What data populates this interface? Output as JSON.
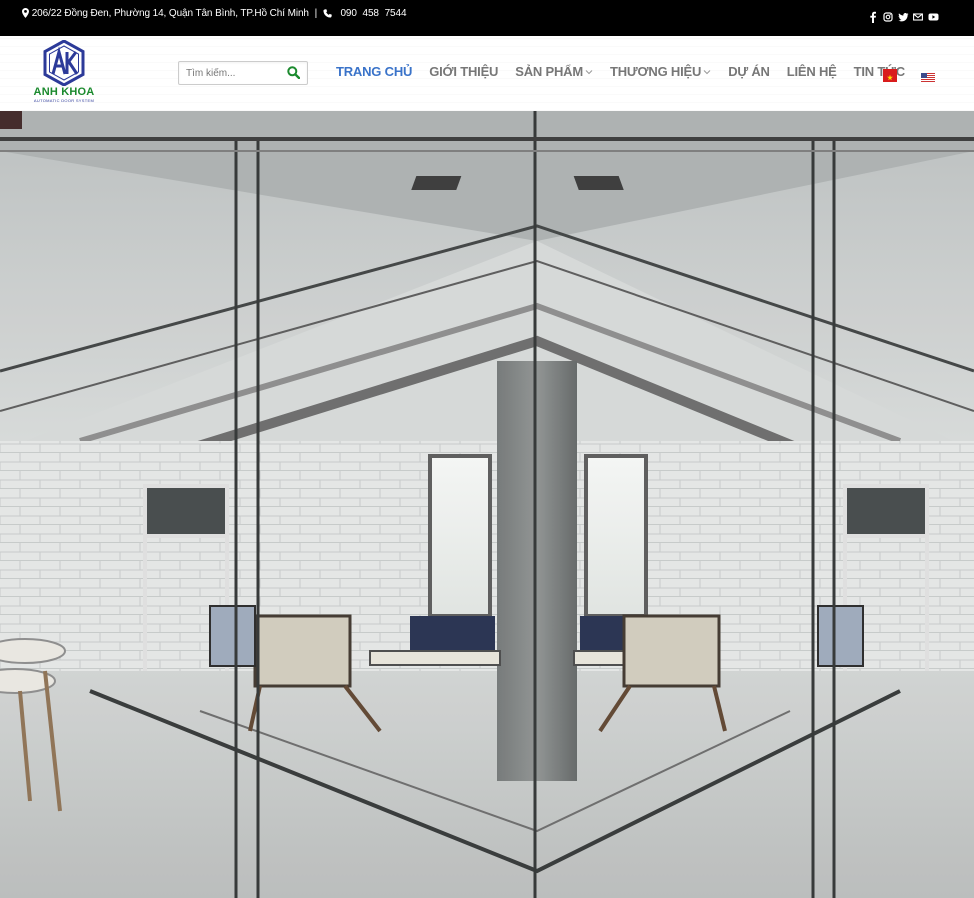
{
  "topbar": {
    "address": "206/22 Đồng Đen, Phường 14, Quận Tân Bình, TP.Hồ Chí Minh",
    "separator": "|",
    "phone": "090  458  7544",
    "social_icons": [
      "facebook-icon",
      "instagram-icon",
      "twitter-icon",
      "email-icon",
      "youtube-icon"
    ]
  },
  "header": {
    "logo_mark": "AK",
    "logo_brand": "ANH KHOA",
    "logo_tagline": "AUTOMATIC DOOR SYSTEM",
    "search_placeholder": "Tìm kiếm...",
    "nav": {
      "home": "TRANG CHỦ",
      "about": "GIỚI THIỆU",
      "products": "SẢN PHẨM",
      "brands": "THƯƠNG HIỆU",
      "projects": "DỰ ÁN",
      "contact": "LIÊN HỆ",
      "news": "TIN TỨC"
    },
    "languages": [
      "vi-flag",
      "en-flag"
    ]
  },
  "hero": {
    "image": "glass-office-partition-mirror-photo"
  },
  "colors": {
    "topbar_bg": "#000000",
    "nav_active": "#3a73c9",
    "nav_default": "#777777",
    "search_icon": "#1b8a2e",
    "logo_green": "#1b8a2e",
    "logo_blue": "#2c3a99"
  }
}
